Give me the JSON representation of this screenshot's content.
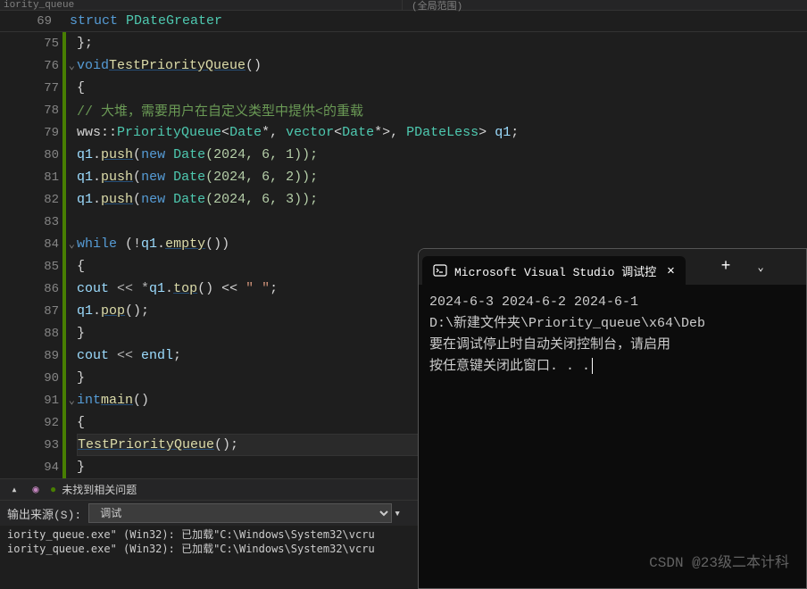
{
  "top_bar": {
    "left": "iority_queue",
    "right": "(全局范围)"
  },
  "struct_line": {
    "num": "69",
    "kw": "struct",
    "name": "PDateGreater"
  },
  "watermark": "CSDN @23级二本计科",
  "gutter": [
    {
      "n": "75"
    },
    {
      "n": "76",
      "fold": true
    },
    {
      "n": "77"
    },
    {
      "n": "78"
    },
    {
      "n": "79"
    },
    {
      "n": "80"
    },
    {
      "n": "81"
    },
    {
      "n": "82"
    },
    {
      "n": "83"
    },
    {
      "n": "84",
      "fold": true
    },
    {
      "n": "85"
    },
    {
      "n": "86"
    },
    {
      "n": "87"
    },
    {
      "n": "88"
    },
    {
      "n": "89"
    },
    {
      "n": "90"
    },
    {
      "n": "91",
      "fold": true
    },
    {
      "n": "92"
    },
    {
      "n": "93"
    },
    {
      "n": "94"
    }
  ],
  "code": {
    "l75": "};",
    "l76": {
      "kw1": "void",
      "fn": "TestPriorityQueue",
      "pun": "()"
    },
    "l77": "{",
    "l78": "// 大堆，需要用户在自定义类型中提供<的重载",
    "l79": {
      "ns": "wws::",
      "cls1": "PriorityQueue",
      "lt": "<",
      "cls2": "Date",
      "ptr1": "*, ",
      "cls3": "vector",
      "lt2": "<",
      "cls4": "Date",
      "ptr2": "*>, ",
      "cls5": "PDateLess",
      "gt": ">",
      "var": " q1",
      "semi": ";"
    },
    "l80": {
      "var": "q1",
      "dot": ".",
      "fn": "push",
      "op": "(",
      "kw": "new",
      "sp": " ",
      "cls": "Date",
      "args": "(2024, 6, 1));"
    },
    "l81": {
      "var": "q1",
      "dot": ".",
      "fn": "push",
      "op": "(",
      "kw": "new",
      "sp": " ",
      "cls": "Date",
      "args": "(2024, 6, 2));"
    },
    "l82": {
      "var": "q1",
      "dot": ".",
      "fn": "push",
      "op": "(",
      "kw": "new",
      "sp": " ",
      "cls": "Date",
      "args": "(2024, 6, 3));"
    },
    "l84": {
      "kw": "while",
      "op": " (!",
      "var": "q1",
      "dot": ".",
      "fn": "empty",
      "end": "())"
    },
    "l85": "{",
    "l86": {
      "var1": "cout",
      "op": " << *",
      "var2": "q1",
      "dot": ".",
      "fn": "top",
      "mid": "() << ",
      "str": "\" \"",
      "semi": ";"
    },
    "l87": {
      "var": "q1",
      "dot": ".",
      "fn": "pop",
      "end": "();"
    },
    "l88": "}",
    "l89": {
      "var1": "cout",
      "op": " << ",
      "var2": "endl",
      "semi": ";"
    },
    "l90": "}",
    "l91": {
      "kw": "int",
      "fn": "main",
      "pun": "()"
    },
    "l92": "{",
    "l93": {
      "fn": "TestPriorityQueue",
      "end": "();"
    },
    "l94": "}"
  },
  "status": {
    "no_issues": "未找到相关问题"
  },
  "output": {
    "label": "输出来源(S):",
    "source": "调试",
    "line1": "iority_queue.exe\" (Win32): 已加载\"C:\\Windows\\System32\\vcru",
    "line2": "iority_queue.exe\" (Win32): 已加载\"C:\\Windows\\System32\\vcru"
  },
  "console": {
    "title": "Microsoft Visual Studio 调试控",
    "line1": "2024-6-3 2024-6-2 2024-6-1",
    "line2": "",
    "line3": "D:\\新建文件夹\\Priority_queue\\x64\\Deb",
    "line4": "要在调试停止时自动关闭控制台，请启用",
    "line5": "按任意键关闭此窗口. . ."
  }
}
